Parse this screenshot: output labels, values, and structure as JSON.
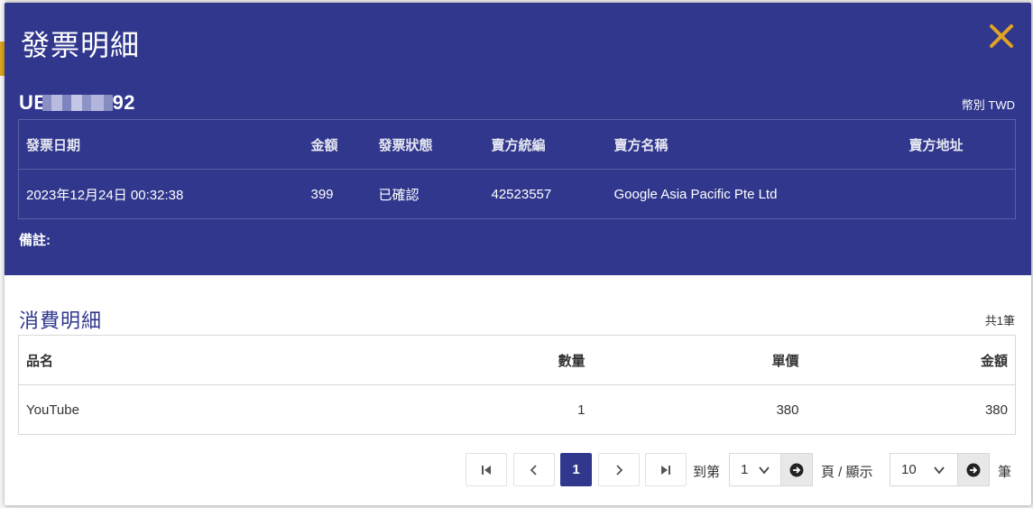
{
  "modal": {
    "title": "發票明細",
    "invoice_number_prefix": "UE",
    "invoice_number_suffix": "92",
    "currency": "幣別 TWD",
    "invoice_table": {
      "headers": [
        "發票日期",
        "金額",
        "發票狀態",
        "賣方統編",
        "賣方名稱",
        "賣方地址"
      ],
      "row": [
        "2023年12月24日 00:32:38",
        "399",
        "已確認",
        "42523557",
        "Google Asia Pacific Pte Ltd",
        ""
      ]
    },
    "remark_label": "備註:"
  },
  "items": {
    "title": "消費明細",
    "total_count": "共1筆",
    "headers": [
      "品名",
      "數量",
      "單價",
      "金額"
    ],
    "rows": [
      [
        "YouTube",
        "1",
        "380",
        "380"
      ]
    ]
  },
  "pagination": {
    "current_page": "1",
    "goto_label": "到第",
    "page_select_value": "1",
    "page_label": "頁 / 顯示",
    "page_size_value": "10",
    "unit_label": "筆"
  },
  "colors": {
    "header_bg": "#30378c",
    "close_icon": "#e0a325",
    "accent": "#30378c"
  },
  "icons": {
    "close": "close-icon",
    "first": "first-page-icon",
    "prev": "chevron-left-icon",
    "next": "chevron-right-icon",
    "last": "last-page-icon",
    "go": "arrow-circle-right-icon",
    "dropdown": "chevron-down-icon"
  }
}
